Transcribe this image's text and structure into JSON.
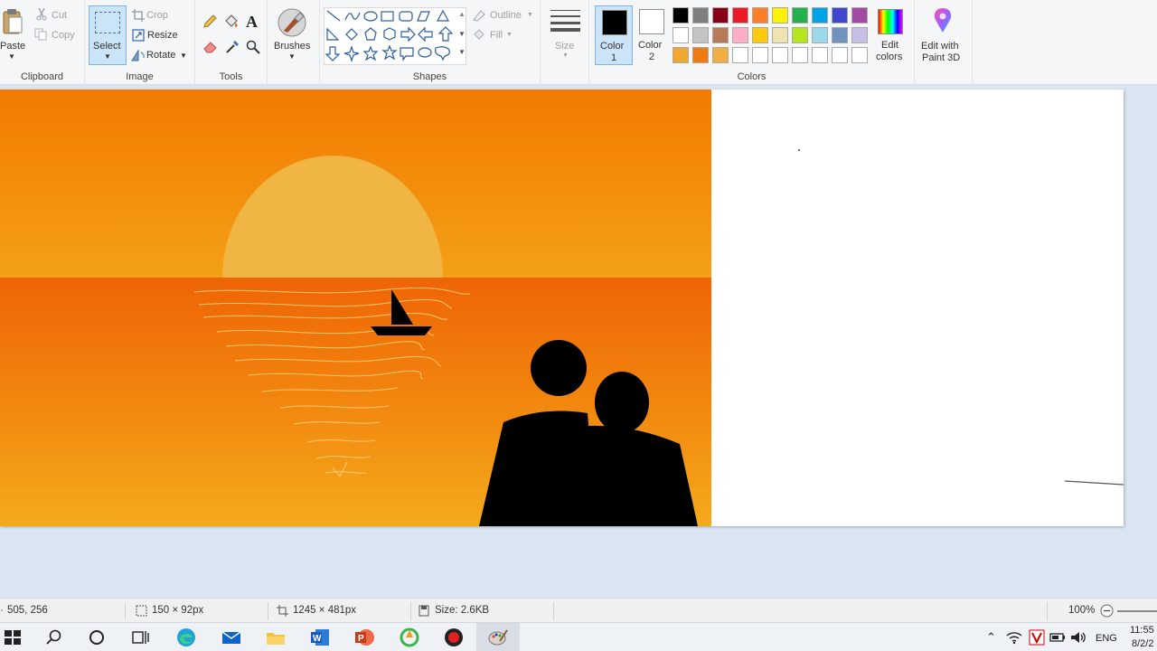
{
  "clipboard": {
    "paste": "Paste",
    "cut": "Cut",
    "copy": "Copy",
    "label": "Clipboard"
  },
  "image": {
    "select": "Select",
    "crop": "Crop",
    "resize": "Resize",
    "rotate": "Rotate",
    "label": "Image"
  },
  "tools": {
    "label": "Tools"
  },
  "brushes": {
    "label": "Brushes"
  },
  "shapes": {
    "outline": "Outline",
    "fill": "Fill",
    "label": "Shapes"
  },
  "size": {
    "label": "Size"
  },
  "colors": {
    "color1_label": "Color",
    "color1_num": "1",
    "color2_label": "Color",
    "color2_num": "2",
    "edit_colors_1": "Edit",
    "edit_colors_2": "colors",
    "paint3d_1": "Edit with",
    "paint3d_2": "Paint 3D",
    "label": "Colors",
    "color1_value": "#000000",
    "color2_value": "#ffffff",
    "palette": [
      "#000000",
      "#7f7f7f",
      "#880015",
      "#ed1c24",
      "#ff7f27",
      "#fff200",
      "#22b14c",
      "#00a2e8",
      "#3f48cc",
      "#a349a4",
      "#ffffff",
      "#c3c3c3",
      "#b97a57",
      "#ffaec9",
      "#ffc90e",
      "#efe4b0",
      "#b5e61d",
      "#99d9ea",
      "#7092be",
      "#c8bfe7",
      "#f0a830",
      "#f07a10",
      "#f0b040",
      "#ffffff",
      "#ffffff",
      "#ffffff",
      "#ffffff",
      "#ffffff",
      "#ffffff",
      "#ffffff"
    ]
  },
  "status": {
    "cursor_pos": "505, 256",
    "selection_size": "150 × 92px",
    "image_size": "1245 × 481px",
    "file_size": "Size: 2.6KB",
    "zoom": "100%"
  },
  "taskbar": {
    "lang": "ENG",
    "time": "11:55",
    "date": "8/2/2"
  }
}
